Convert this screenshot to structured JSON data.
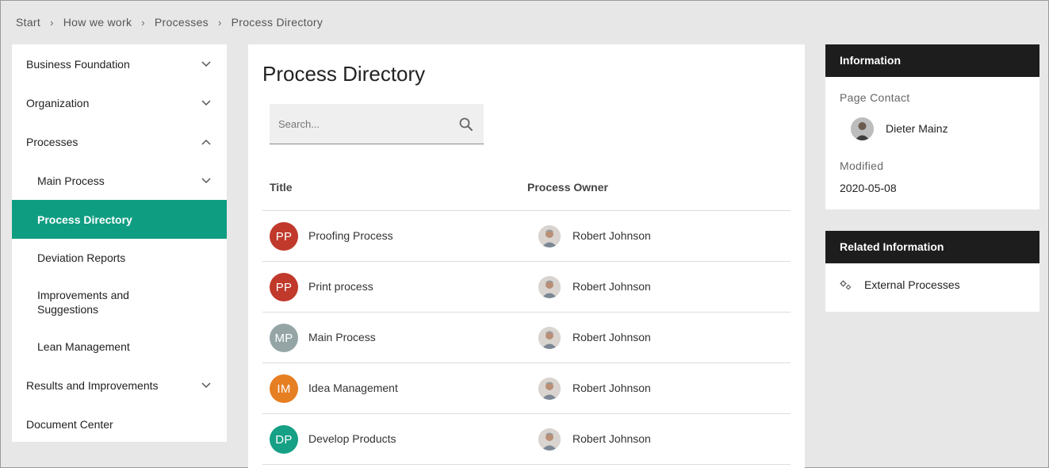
{
  "breadcrumb": [
    "Start",
    "How we work",
    "Processes",
    "Process Directory"
  ],
  "breadcrumb_separator": "›",
  "nav": {
    "items": [
      {
        "label": "Business Foundation",
        "chevron": "down"
      },
      {
        "label": "Organization",
        "chevron": "down"
      },
      {
        "label": "Processes",
        "chevron": "up"
      },
      {
        "label": "Main Process",
        "chevron": "down"
      },
      {
        "label": "Process Directory"
      },
      {
        "label": "Deviation Reports"
      },
      {
        "label": "Improvements and Suggestions"
      },
      {
        "label": "Lean Management"
      },
      {
        "label": "Results and Improvements",
        "chevron": "down"
      },
      {
        "label": "Document Center"
      }
    ],
    "active_color": "#0f9d82"
  },
  "main": {
    "title": "Process Directory",
    "search_placeholder": "Search...",
    "columns": [
      "Title",
      "Process Owner"
    ],
    "rows": [
      {
        "initials": "PP",
        "color": "#c0392b",
        "title": "Proofing Process",
        "owner": "Robert Johnson"
      },
      {
        "initials": "PP",
        "color": "#c0392b",
        "title": "Print process",
        "owner": "Robert Johnson"
      },
      {
        "initials": "MP",
        "color": "#95a5a6",
        "title": "Main Process",
        "owner": "Robert Johnson"
      },
      {
        "initials": "IM",
        "color": "#e67e22",
        "title": "Idea Management",
        "owner": "Robert Johnson"
      },
      {
        "initials": "DP",
        "color": "#16a085",
        "title": "Develop Products",
        "owner": "Robert Johnson"
      }
    ]
  },
  "info": {
    "header": "Information",
    "page_contact_label": "Page Contact",
    "page_contact_name": "Dieter Mainz",
    "modified_label": "Modified",
    "modified_value": "2020-05-08"
  },
  "related": {
    "header": "Related Information",
    "link_label": "External Processes",
    "link_icon": "gears-icon"
  }
}
